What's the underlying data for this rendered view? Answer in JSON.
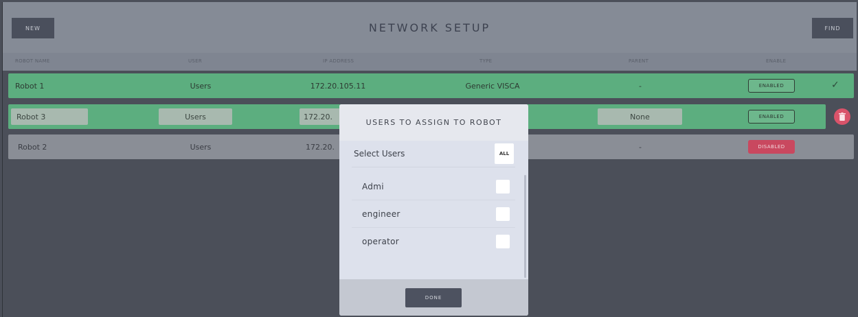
{
  "header": {
    "title": "NETWORK SETUP",
    "new_label": "NEW",
    "find_label": "FIND"
  },
  "columns": [
    "ROBOT NAME",
    "USER",
    "IP ADDRESS",
    "TYPE",
    "PARENT",
    "ENABLE"
  ],
  "rows": [
    {
      "name": "Robot 1",
      "users": "Users",
      "ip": "172.20.105.11",
      "type": "Generic VISCA",
      "parent": "-",
      "status": "ENABLED"
    },
    {
      "name": "Robot 3",
      "users": "Users",
      "ip": "172.20.",
      "parent": "None",
      "status": "ENABLED"
    },
    {
      "name": "Robot 2",
      "users": "Users",
      "ip": "172.20.",
      "parent": "-",
      "status": "DISABLED"
    }
  ],
  "modal": {
    "title": "USERS TO ASSIGN TO ROBOT",
    "select_label": "Select Users",
    "all_label": "ALL",
    "users": [
      "Admi",
      "engineer",
      "operator"
    ],
    "done_label": "DONE"
  },
  "icons": {
    "row1_check": "check-icon",
    "row3_delete": "trash-icon"
  },
  "colors": {
    "enabled_row": "#5cae7f",
    "disabled_row": "#8a8e96",
    "disabled_badge": "#c9485f",
    "delete_button": "#d9536a"
  }
}
